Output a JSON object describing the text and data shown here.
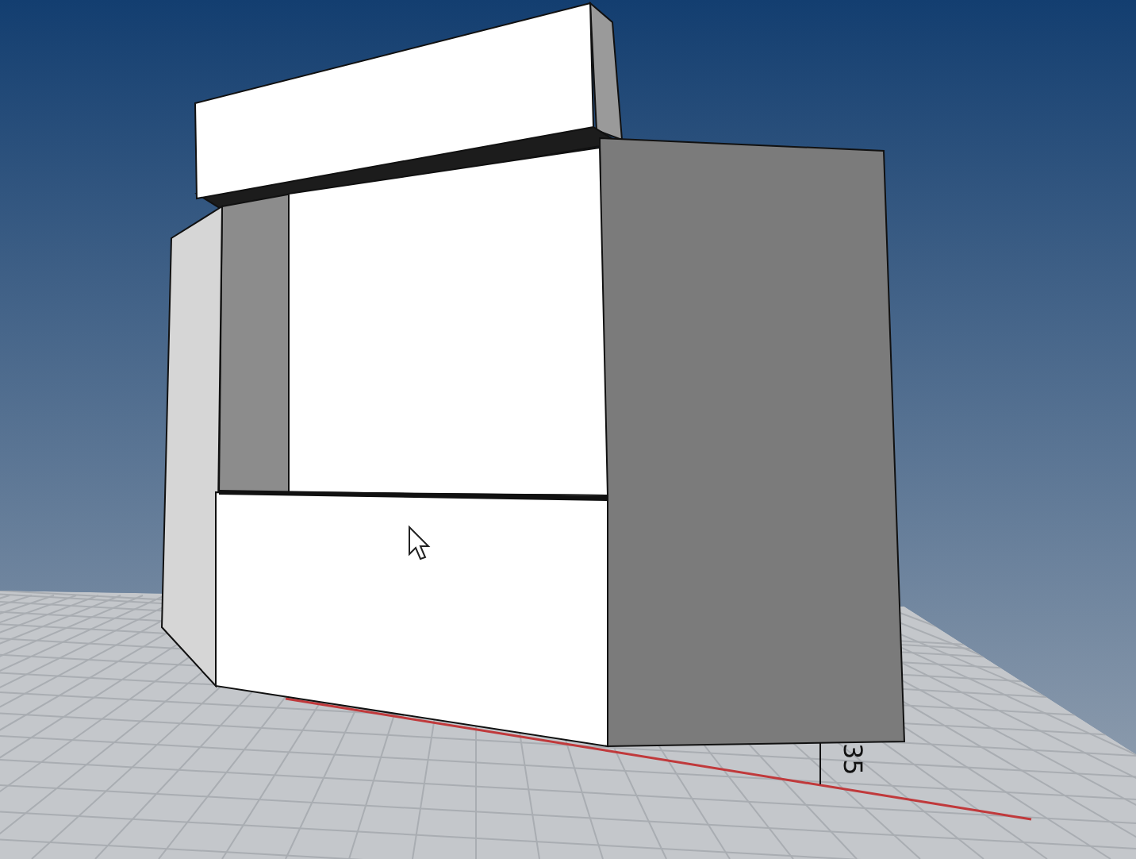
{
  "viewport": {
    "dimension_label": "35"
  }
}
